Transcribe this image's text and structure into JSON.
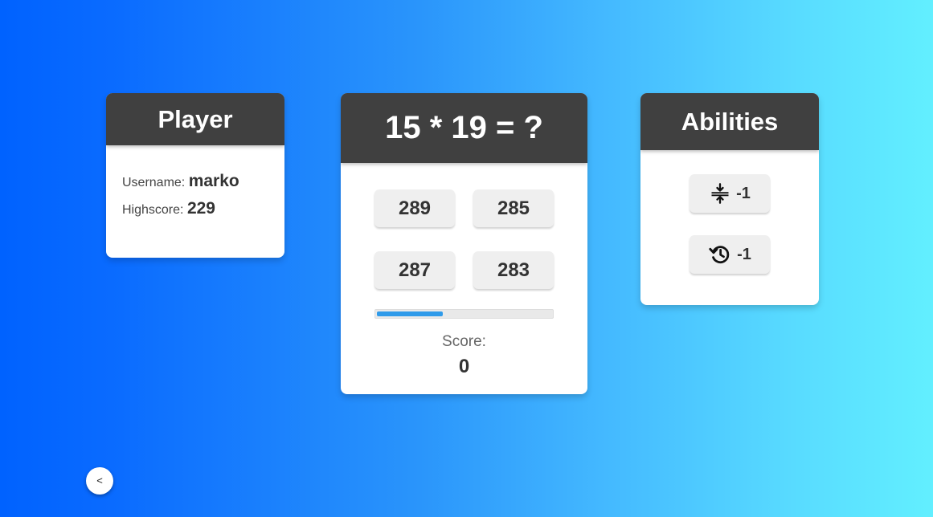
{
  "player": {
    "title": "Player",
    "username_label": "Username:",
    "username": "marko",
    "highscore_label": "Highscore:",
    "highscore": "229"
  },
  "question": {
    "text": "15 * 19 = ?",
    "answers": [
      "289",
      "285",
      "287",
      "283"
    ],
    "timer_progress": 0.38,
    "timer_color": "#2f9bea",
    "score_label": "Score:",
    "score": "0"
  },
  "abilities": {
    "title": "Abilities",
    "items": [
      {
        "icon": "compress-vertical-icon",
        "cost": "-1"
      },
      {
        "icon": "history-icon",
        "cost": "-1"
      }
    ]
  },
  "nav": {
    "back_label": "<"
  },
  "colors": {
    "header_bg": "#404040",
    "background_start": "#0062ff",
    "background_end": "#62efff"
  }
}
